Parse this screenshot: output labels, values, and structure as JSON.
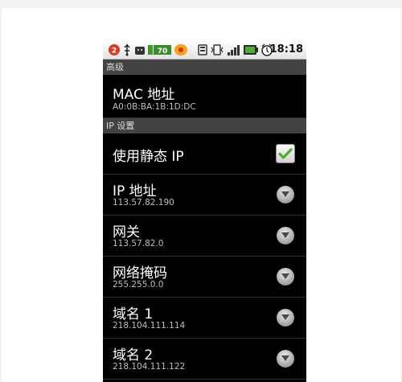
{
  "status_bar": {
    "time": "18:18",
    "notification_count": "2",
    "battery_text": "70",
    "icons": [
      "notification-badge-icon",
      "usb-icon",
      "android-icon",
      "battery-icon",
      "browser-icon",
      "signal-tower-icon",
      "vibrate-icon",
      "signal-bars-icon",
      "green-battery-icon",
      "alarm-clock-icon"
    ]
  },
  "header": {
    "label": "高级"
  },
  "mac": {
    "title": "MAC 地址",
    "value": "A0:0B:BA:1B:1D:DC"
  },
  "ip_section": {
    "label": "IP 设置"
  },
  "static_ip": {
    "title": "使用静态 IP",
    "checked": true
  },
  "fields": [
    {
      "title": "IP 地址",
      "value": "113.57.82.190"
    },
    {
      "title": "网关",
      "value": "113.57.82.0"
    },
    {
      "title": "网络掩码",
      "value": "255.255.0.0"
    },
    {
      "title": "域名 1",
      "value": "218.104.111.114"
    },
    {
      "title": "域名 2",
      "value": "218.104.111.122"
    }
  ],
  "colors": {
    "check_green": "#4cae32",
    "section_bg": "#434343",
    "background": "#000000"
  }
}
